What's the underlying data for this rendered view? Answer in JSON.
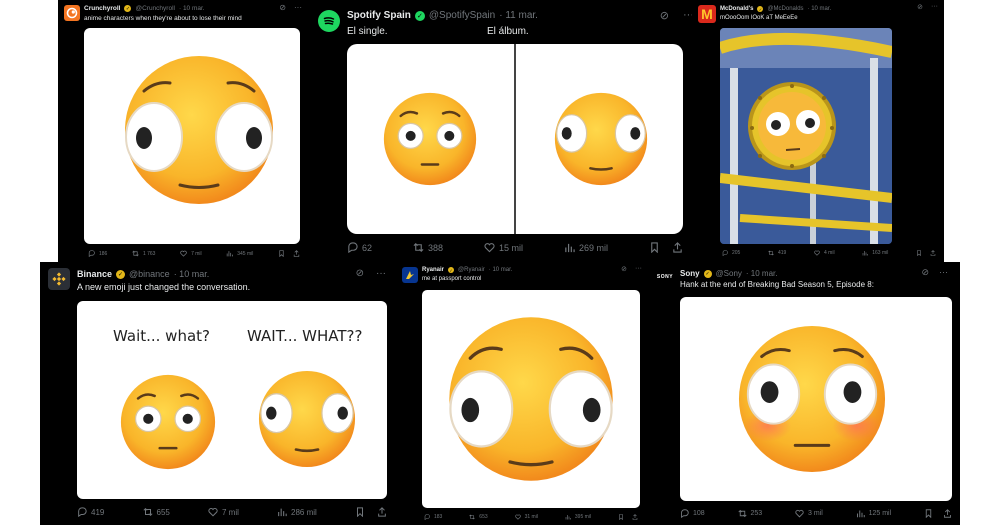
{
  "tweets": [
    {
      "name": "Crunchyroll",
      "handle": "@Crunchyroll",
      "date": "· 10 mar.",
      "text": "anime characters when they're about to lose their mind",
      "logo_color": "#f47521",
      "stats": {
        "replies": "186",
        "retweets": "1 763",
        "likes": "7 mil",
        "views": "345 mil"
      }
    },
    {
      "name": "Spotify Spain",
      "handle": "@SpotifySpain",
      "date": "· 11 mar.",
      "text": "El single.",
      "text2": "El álbum.",
      "logo_color": "#1ed760",
      "stats": {
        "replies": "62",
        "retweets": "388",
        "likes": "15 mil",
        "views": "269 mil"
      }
    },
    {
      "name": "McDonald's",
      "handle": "@McDonalds",
      "date": "· 10 mar.",
      "text": "mOooOom lOoK aT MeEeEe",
      "logo_color": "#da291c",
      "stats": {
        "replies": "205",
        "retweets": "419",
        "likes": "4 mil",
        "views": "163 mil"
      }
    },
    {
      "name": "Binance",
      "handle": "@binance",
      "date": "· 10 mar.",
      "text": "A new emoji just changed the conversation.",
      "logo_color": "#f3ba2f",
      "captions": [
        "Wait... what?",
        "WAIT... WHAT??"
      ],
      "stats": {
        "replies": "419",
        "retweets": "655",
        "likes": "7 mil",
        "views": "286 mil"
      }
    },
    {
      "name": "Ryanair",
      "handle": "@Ryanair",
      "date": "· 10 mar.",
      "text": "me at passport control",
      "logo_color": "#073590",
      "stats": {
        "replies": "183",
        "retweets": "653",
        "likes": "31 mil",
        "views": "395 mil"
      }
    },
    {
      "name": "Sony",
      "handle": "@Sony",
      "date": "· 10 mar.",
      "text": "Hank at the end of Breaking Bad Season 5, Episode 8:",
      "logo_text": "SONY",
      "stats": {
        "replies": "108",
        "retweets": "253",
        "likes": "3 mil",
        "views": "125 mil"
      }
    }
  ],
  "icons": [
    "reply-icon",
    "retweet-icon",
    "like-icon",
    "views-icon",
    "bookmark-icon",
    "share-icon",
    "grok-icon",
    "more-icon",
    "verified-icon"
  ]
}
